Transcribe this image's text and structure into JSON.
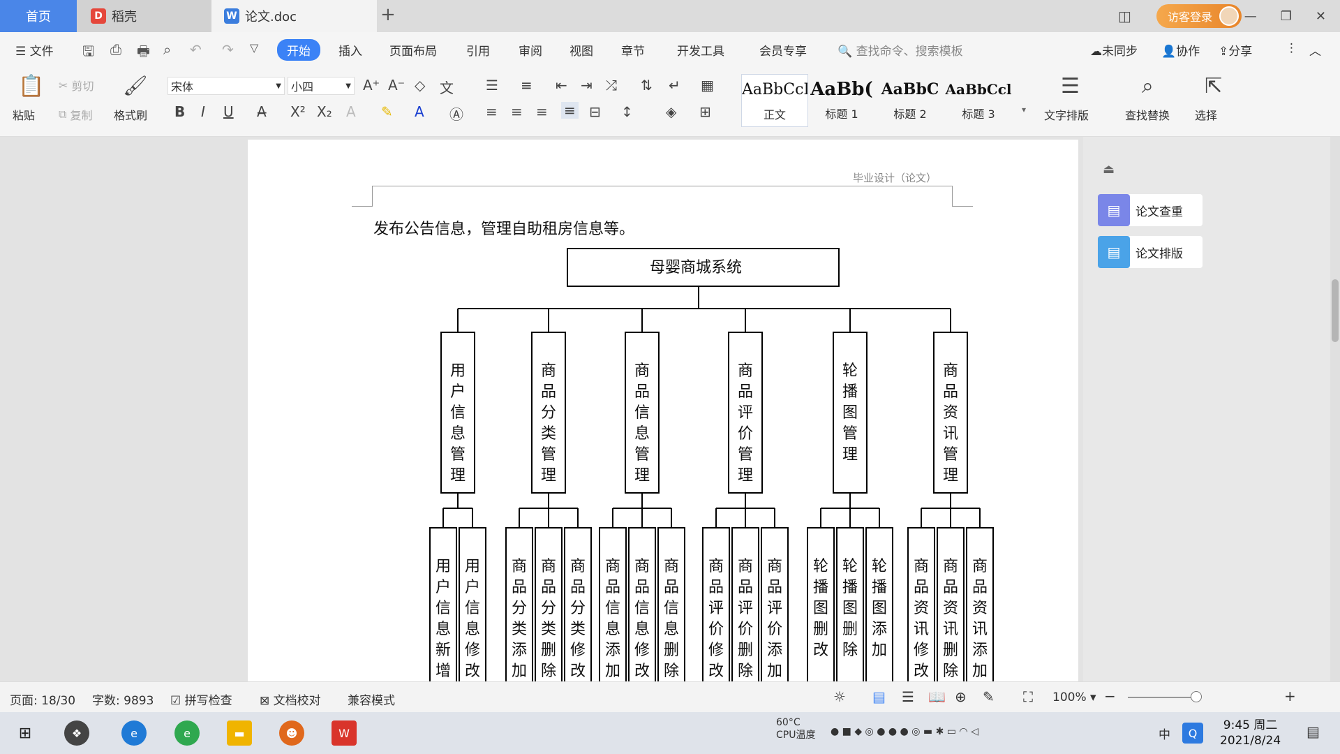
{
  "tabs": {
    "home": "首页",
    "daoke": "稻壳",
    "doc": "论文.doc",
    "new": "+"
  },
  "login": "访客登录",
  "menu": {
    "file": "文件",
    "start": "开始",
    "insert": "插入",
    "layout": "页面布局",
    "ref": "引用",
    "review": "审阅",
    "view": "视图",
    "chapter": "章节",
    "dev": "开发工具",
    "member": "会员专享",
    "search": "查找命令、搜索模板",
    "unsync": "未同步",
    "collab": "协作",
    "share": "分享"
  },
  "ribbon": {
    "paste": "粘贴",
    "cut": "剪切",
    "copy": "复制",
    "painter": "格式刷",
    "font": "宋体",
    "size": "小四",
    "textlayout": "文字排版",
    "findreplace": "查找替换",
    "select": "选择"
  },
  "styles": [
    {
      "pv": "AaBbCcI",
      "lbl": "正文"
    },
    {
      "pv": "AaBb(",
      "lbl": "标题 1"
    },
    {
      "pv": "AaBbC",
      "lbl": "标题 2"
    },
    {
      "pv": "AaBbCcl",
      "lbl": "标题 3"
    }
  ],
  "doc": {
    "header": "毕业设计（论文）",
    "body": "发布公告信息，管理自助租房信息等。",
    "root": "母婴商城系统",
    "modules": [
      {
        "name": "用户信息管理",
        "children": [
          "用户信息新增",
          "用户信息修改"
        ]
      },
      {
        "name": "商品分类管理",
        "children": [
          "商品分类添加",
          "商品分类删除",
          "商品分类修改"
        ]
      },
      {
        "name": "商品信息管理",
        "children": [
          "商品信息添加",
          "商品信息修改",
          "商品信息删除"
        ]
      },
      {
        "name": "商品评价管理",
        "children": [
          "商品评价修改",
          "商品评价删除",
          "商品评价添加"
        ]
      },
      {
        "name": "轮播图管理",
        "children": [
          "轮播图删改",
          "轮播图删除",
          "轮播图添加"
        ]
      },
      {
        "name": "商品资讯管理",
        "children": [
          "商品资讯修改",
          "商品资讯删除",
          "商品资讯添加"
        ]
      }
    ]
  },
  "side": {
    "check": "论文查重",
    "format": "论文排版"
  },
  "status": {
    "page": "页面: 18/30",
    "words": "字数: 9893",
    "spell": "拼写检查",
    "proof": "文档校对",
    "compat": "兼容模式",
    "zoom": "100%"
  },
  "taskbar": {
    "temp": "60°C",
    "cpu": "CPU温度",
    "ime": "中",
    "time": "9:45 周二",
    "date": "2021/8/24"
  }
}
